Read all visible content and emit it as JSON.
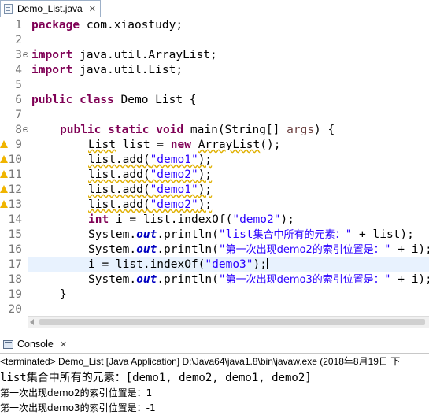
{
  "editor": {
    "tab_label": "Demo_List.java",
    "close_glyph": "✕",
    "code": {
      "l1_kw": "package",
      "l1_rest": " com.xiaostudy;",
      "l3_kw": "import",
      "l3_rest": " java.util.ArrayList;",
      "l4_kw": "import",
      "l4_rest": " java.util.List;",
      "l6_kw1": "public",
      "l6_kw2": "class",
      "l6_rest": " Demo_List {",
      "l8_kw1": "public",
      "l8_kw2": "static",
      "l8_kw3": "void",
      "l8_mid": " main(String[] ",
      "l8_var": "args",
      "l8_end": ") {",
      "l9_a": "List",
      "l9_b": " list = ",
      "l9_kw": "new",
      "l9_c": " ",
      "l9_d": "ArrayList",
      "l9_e": "();",
      "l10_call": "list.add(",
      "l10_str": "\"demo1\"",
      "l10_end": ");",
      "l11_call": "list.add(",
      "l11_str": "\"demo2\"",
      "l11_end": ");",
      "l12_call": "list.add(",
      "l12_str": "\"demo1\"",
      "l12_end": ");",
      "l13_call": "list.add(",
      "l13_str": "\"demo2\"",
      "l13_end": ");",
      "l14_kw": "int",
      "l14_mid": " i = list.indexOf(",
      "l14_str": "\"demo2\"",
      "l14_end": ");",
      "l15_a": "System.",
      "l15_out": "out",
      "l15_b": ".println(",
      "l15_str1": "\"list",
      "l15_cjk": "集合中所有的元素：",
      "l15_str2": "\"",
      "l15_end": " + list);",
      "l16_a": "System.",
      "l16_out": "out",
      "l16_b": ".println(",
      "l16_str1": "\"",
      "l16_cjk": "第一次出现demo2的索引位置是：",
      "l16_str2": "\"",
      "l16_end": " + i);",
      "l17_a": "i = list.indexOf(",
      "l17_str": "\"demo3\"",
      "l17_end": ");",
      "l18_a": "System.",
      "l18_out": "out",
      "l18_b": ".println(",
      "l18_str1": "\"",
      "l18_cjk": "第一次出现demo3的索引位置是：",
      "l18_str2": "\"",
      "l18_end": " + i);",
      "l19": "}"
    },
    "line_numbers": [
      "1",
      "2",
      "3",
      "4",
      "5",
      "6",
      "7",
      "8",
      "9",
      "10",
      "11",
      "12",
      "13",
      "14",
      "15",
      "16",
      "17",
      "18",
      "19",
      "20"
    ]
  },
  "console": {
    "tab_label": "Console",
    "close_glyph": "✕",
    "status": "<terminated> Demo_List [Java Application] D:\\Java64\\java1.8\\bin\\javaw.exe (2018年8月19日 下",
    "output": [
      "list集合中所有的元素：[demo1, demo2, demo1, demo2]",
      "第一次出现demo2的索引位置是：1",
      "第一次出现demo3的索引位置是：-1"
    ]
  },
  "colors": {
    "keyword": "#7f0055",
    "string": "#2a00ff",
    "static_field": "#0000c0",
    "line_number": "#787878",
    "current_line": "#e8f2fe",
    "warning": "#f0b400"
  },
  "icons": {
    "editor_tab": "java-file-icon",
    "console_tab": "console-icon",
    "gutter_warning": "warning-icon",
    "gutter_fold": "fold-collapse-icon"
  }
}
